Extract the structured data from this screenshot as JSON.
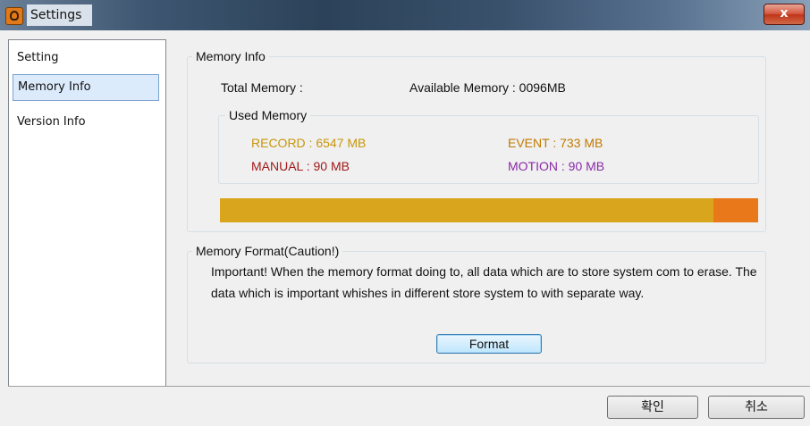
{
  "window": {
    "title": "Settings",
    "close_label": "x"
  },
  "sidebar": {
    "items": [
      {
        "label": "Setting",
        "selected": false
      },
      {
        "label": "Memory Info",
        "selected": true
      },
      {
        "label": "Version Info",
        "selected": false
      }
    ]
  },
  "memory_info": {
    "legend": "Memory Info",
    "total_label": "Total Memory :",
    "available_label": "Available Memory : 0096MB",
    "used": {
      "legend": "Used Memory",
      "record": "RECORD : 6547 MB",
      "event": "EVENT : 733 MB",
      "manual": "MANUAL : 90 MB",
      "motion": "MOTION : 90 MB"
    },
    "usage_bar": {
      "primary_color": "#d8a51c",
      "secondary_color": "#e8781a",
      "secondary_fraction": 0.083
    }
  },
  "memory_format": {
    "legend": "Memory Format(Caution!)",
    "caution_text": "Important! When the memory format doing to, all data which are to store system com to erase. The data which is important whishes in different store system to with separate way.",
    "format_button": "Format"
  },
  "footer": {
    "ok_label": "확인",
    "cancel_label": "취소"
  }
}
